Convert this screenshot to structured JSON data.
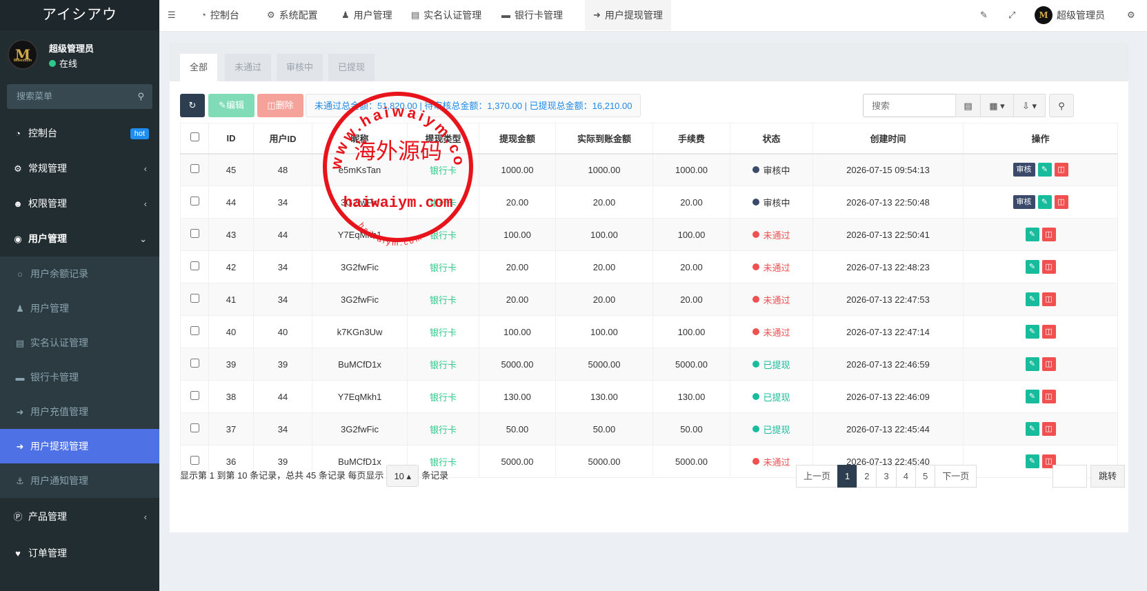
{
  "brand": "アイシアウ",
  "user": {
    "name": "超级管理员",
    "status": "在线",
    "avatar_text": "M",
    "avatar_sub": "Millennium"
  },
  "side_search": {
    "placeholder": "搜索菜单"
  },
  "menu": [
    {
      "label": "控制台",
      "icon": "dashboard-icon",
      "badge": "hot"
    },
    {
      "label": "常规管理",
      "icon": "cogs-icon"
    },
    {
      "label": "权限管理",
      "icon": "users-icon"
    },
    {
      "label": "用户管理",
      "icon": "user-circle-icon"
    }
  ],
  "submenu": [
    {
      "label": "用户余额记录",
      "icon": "circle-icon"
    },
    {
      "label": "用户管理",
      "icon": "user-icon"
    },
    {
      "label": "实名认证管理",
      "icon": "id-card-icon"
    },
    {
      "label": "银行卡管理",
      "icon": "credit-card-icon"
    },
    {
      "label": "用户充值管理",
      "icon": "sign-in-icon"
    },
    {
      "label": "用户提现管理",
      "icon": "sign-out-icon",
      "active": true
    },
    {
      "label": "用户通知管理",
      "icon": "anchor-icon"
    }
  ],
  "menu_bottom": [
    {
      "label": "产品管理",
      "icon": "product-hunt-icon"
    },
    {
      "label": "订单管理",
      "icon": "heartbeat-icon"
    }
  ],
  "topnav": [
    {
      "label": "控制台",
      "icon": "dashboard-icon"
    },
    {
      "label": "系统配置",
      "icon": "gear-icon"
    },
    {
      "label": "用户管理",
      "icon": "user-icon"
    },
    {
      "label": "实名认证管理",
      "icon": "id-card-icon"
    },
    {
      "label": "银行卡管理",
      "icon": "credit-card-icon"
    },
    {
      "label": "用户提现管理",
      "icon": "sign-out-icon",
      "active": true
    }
  ],
  "topbar_user": "超级管理员",
  "tabs": [
    "全部",
    "未通过",
    "审核中",
    "已提现"
  ],
  "toolbar": {
    "edit_label": "编辑",
    "delete_label": "删除",
    "summary": "未通过总金额：51,820.00 | 待审核总金额：1,370.00 | 已提现总金额：16,210.00",
    "search_placeholder": "搜索"
  },
  "columns": [
    "ID",
    "用户ID",
    "昵称",
    "提现类型",
    "提现金额",
    "实际到账金额",
    "手续费",
    "状态",
    "创建时间",
    "操作"
  ],
  "rows": [
    {
      "id": "45",
      "uid": "48",
      "nick": "e5mKsTan",
      "type": "银行卡",
      "amount": "1000.00",
      "actual": "1000.00",
      "fee": "1000.00",
      "status": "审核中",
      "status_kind": "pending",
      "time": "2026-07-15 09:54:13",
      "audit": "审核"
    },
    {
      "id": "44",
      "uid": "34",
      "nick": "3G2fwFic",
      "type": "银行卡",
      "amount": "20.00",
      "actual": "20.00",
      "fee": "20.00",
      "status": "审核中",
      "status_kind": "pending",
      "time": "2026-07-13 22:50:48",
      "audit": "审核"
    },
    {
      "id": "43",
      "uid": "44",
      "nick": "Y7EqMkh1",
      "type": "银行卡",
      "amount": "100.00",
      "actual": "100.00",
      "fee": "100.00",
      "status": "未通过",
      "status_kind": "fail",
      "time": "2026-07-13 22:50:41"
    },
    {
      "id": "42",
      "uid": "34",
      "nick": "3G2fwFic",
      "type": "银行卡",
      "amount": "20.00",
      "actual": "20.00",
      "fee": "20.00",
      "status": "未通过",
      "status_kind": "fail",
      "time": "2026-07-13 22:48:23"
    },
    {
      "id": "41",
      "uid": "34",
      "nick": "3G2fwFic",
      "type": "银行卡",
      "amount": "20.00",
      "actual": "20.00",
      "fee": "20.00",
      "status": "未通过",
      "status_kind": "fail",
      "time": "2026-07-13 22:47:53"
    },
    {
      "id": "40",
      "uid": "40",
      "nick": "k7KGn3Uw",
      "type": "银行卡",
      "amount": "100.00",
      "actual": "100.00",
      "fee": "100.00",
      "status": "未通过",
      "status_kind": "fail",
      "time": "2026-07-13 22:47:14"
    },
    {
      "id": "39",
      "uid": "39",
      "nick": "BuMCfD1x",
      "type": "银行卡",
      "amount": "5000.00",
      "actual": "5000.00",
      "fee": "5000.00",
      "status": "已提现",
      "status_kind": "ok",
      "time": "2026-07-13 22:46:59"
    },
    {
      "id": "38",
      "uid": "44",
      "nick": "Y7EqMkh1",
      "type": "银行卡",
      "amount": "130.00",
      "actual": "130.00",
      "fee": "130.00",
      "status": "已提现",
      "status_kind": "ok",
      "time": "2026-07-13 22:46:09"
    },
    {
      "id": "37",
      "uid": "34",
      "nick": "3G2fwFic",
      "type": "银行卡",
      "amount": "50.00",
      "actual": "50.00",
      "fee": "50.00",
      "status": "已提现",
      "status_kind": "ok",
      "time": "2026-07-13 22:45:44"
    },
    {
      "id": "36",
      "uid": "39",
      "nick": "BuMCfD1x",
      "type": "银行卡",
      "amount": "5000.00",
      "actual": "5000.00",
      "fee": "5000.00",
      "status": "未通过",
      "status_kind": "fail",
      "time": "2026-07-13 22:45:40"
    }
  ],
  "footer": {
    "info_prefix": "显示第 1 到第 10 条记录，总共 45 条记录 每页显示",
    "page_size": "10",
    "info_suffix": "条记录"
  },
  "pager": {
    "prev": "上一页",
    "pages": [
      "1",
      "2",
      "3",
      "4",
      "5"
    ],
    "current": "1",
    "next": "下一页",
    "jump": "跳转"
  },
  "watermark": {
    "arc_text": "www.haiwaiym.com",
    "center_text": "海外源码",
    "domain": "haiwaiym.com",
    "small": "haiwaiym.com",
    "color": "#e8141b"
  }
}
